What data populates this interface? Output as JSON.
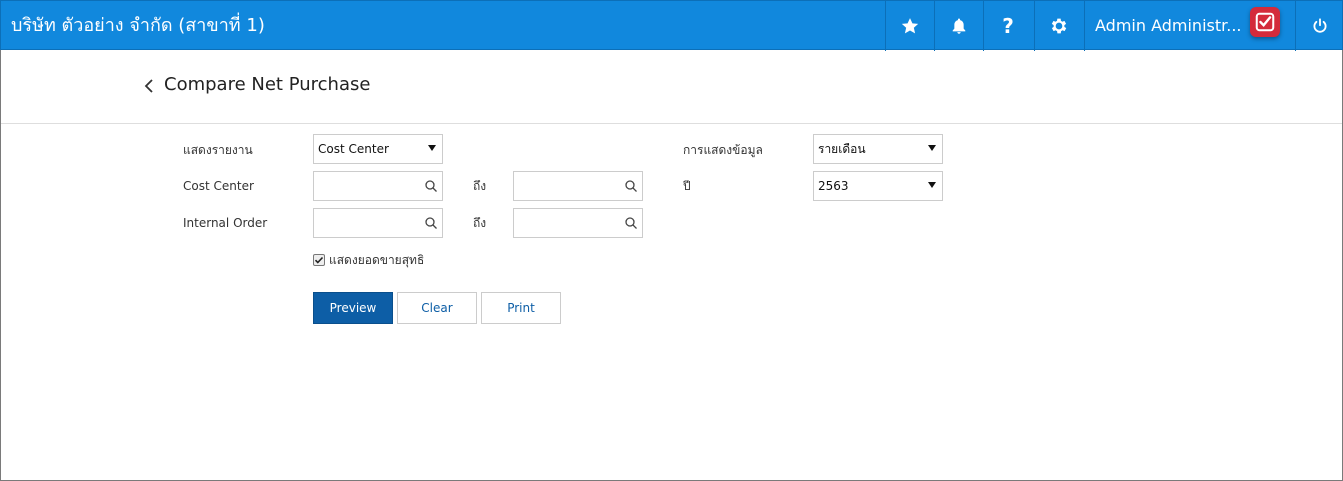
{
  "header": {
    "company": "บริษัท ตัวอย่าง จำกัด (สาขาที่ 1)",
    "user_name": "Admin Administr...",
    "brand_color": "#1188dd",
    "icons": [
      "star-icon",
      "bell-icon",
      "help-icon",
      "gear-icon",
      "avatar-logo",
      "power-icon"
    ],
    "help_label": "?"
  },
  "page": {
    "title": "Compare Net Purchase"
  },
  "form": {
    "report_label": "แสดงรายงาน",
    "report_value": "Cost Center",
    "display_label": "การแสดงข้อมูล",
    "display_value": "รายเดือน",
    "cost_center_label": "Cost Center",
    "cost_center_from": "",
    "to_label": "ถึง",
    "cost_center_to": "",
    "year_label": "ปี",
    "year_value": "2563",
    "internal_order_label": "Internal Order",
    "internal_order_from": "",
    "internal_order_to": "",
    "net_sales_label": "แสดงยอดขายสุทธิ",
    "net_sales_checked": true
  },
  "buttons": {
    "preview": "Preview",
    "clear": "Clear",
    "print": "Print"
  }
}
